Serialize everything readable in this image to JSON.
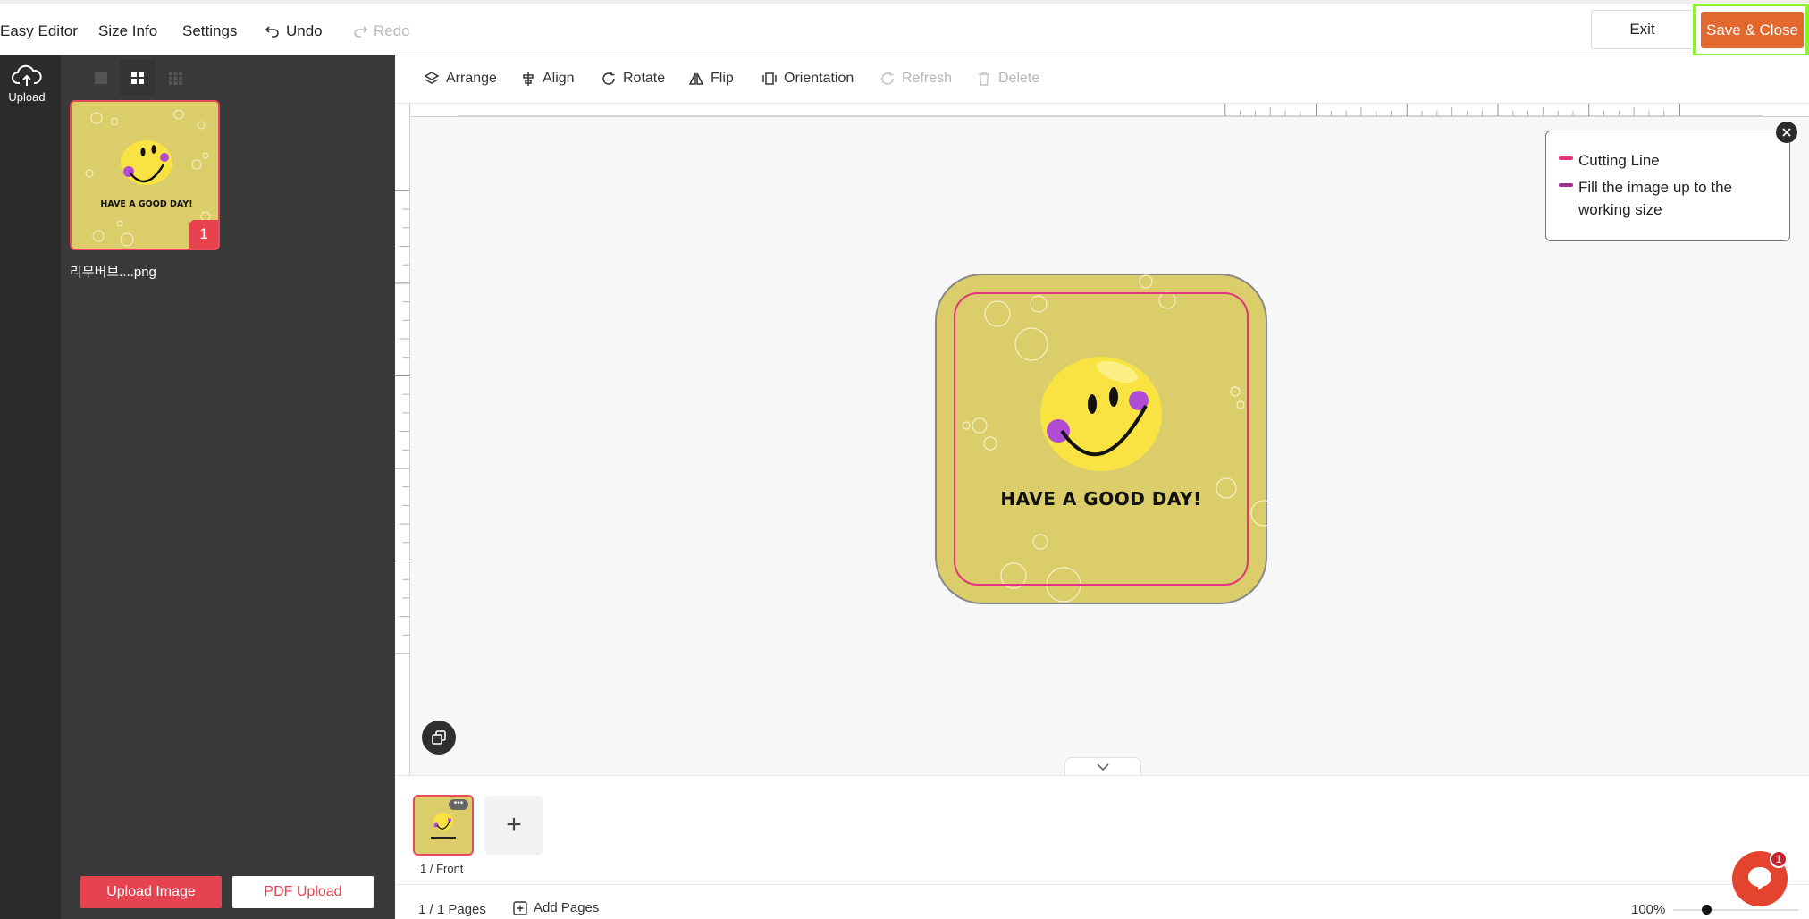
{
  "topbar": {
    "title": "Easy Editor",
    "menu": [
      "Size Info",
      "Settings"
    ],
    "undo_label": "Undo",
    "redo_label": "Redo",
    "exit_label": "Exit",
    "save_label": "Save & Close"
  },
  "rail": {
    "upload_label": "Upload"
  },
  "panel": {
    "file_name": "리무버브....png",
    "file_badge": "1",
    "upload_image_label": "Upload Image",
    "pdf_upload_label": "PDF Upload"
  },
  "toolbar": {
    "arrange": "Arrange",
    "align": "Align",
    "rotate": "Rotate",
    "flip": "Flip",
    "orientation": "Orientation",
    "refresh": "Refresh",
    "delete": "Delete"
  },
  "canvas": {
    "sticker_text": "HAVE A GOOD DAY!",
    "background_color": "#dccd6b",
    "cutting_line_color": "#e0357d",
    "fill_line_color": "#9c2c8e"
  },
  "legend": {
    "cutting_line": "Cutting Line",
    "fill_image": "Fill the image up to the working size"
  },
  "pages": {
    "page_label": "1 / Front",
    "add_symbol": "+"
  },
  "status": {
    "page_count": "1 / 1 Pages",
    "add_pages": "Add Pages",
    "zoom": "100%",
    "zoom_level": 0.27
  },
  "chat": {
    "badge": "1"
  },
  "colors": {
    "accent": "#e2682d",
    "highlight": "#8ef22a",
    "danger": "#e4434f",
    "dark_panel": "#3a3a3b"
  }
}
